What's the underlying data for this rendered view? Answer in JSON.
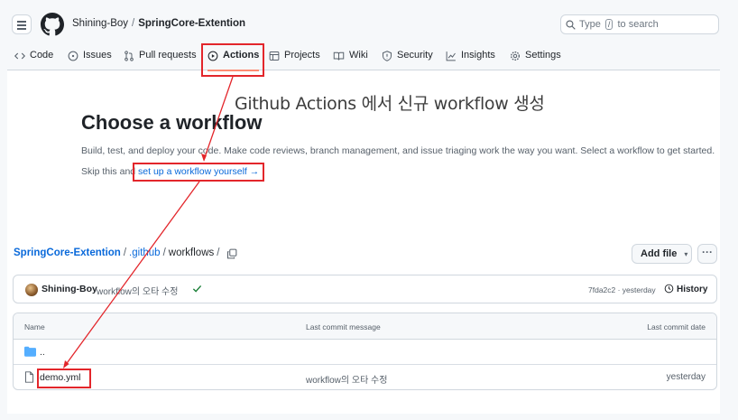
{
  "header": {
    "owner": "Shining-Boy",
    "separator": "/",
    "repo": "SpringCore-Extention",
    "search_prefix": "Type",
    "search_key": "/",
    "search_suffix": "to search"
  },
  "tabs": [
    {
      "label": "Code",
      "icon": "code-icon"
    },
    {
      "label": "Issues",
      "icon": "issue-icon"
    },
    {
      "label": "Pull requests",
      "icon": "pull-request-icon"
    },
    {
      "label": "Actions",
      "icon": "play-icon",
      "selected": true
    },
    {
      "label": "Projects",
      "icon": "table-icon"
    },
    {
      "label": "Wiki",
      "icon": "book-icon"
    },
    {
      "label": "Security",
      "icon": "shield-icon"
    },
    {
      "label": "Insights",
      "icon": "graph-icon"
    },
    {
      "label": "Settings",
      "icon": "gear-icon"
    }
  ],
  "annotation": "Github Actions 에서 신규 workflow 생성",
  "main": {
    "title": "Choose a workflow",
    "description": "Build, test, and deploy your code. Make code reviews, branch management, and issue triaging work the way you want. Select a workflow to get started.",
    "skip_prefix": "Skip this and",
    "skip_link": "set up a workflow yourself",
    "skip_arrow": "→"
  },
  "path": {
    "repo": "SpringCore-Extention",
    "dir1": ".github",
    "dir2": "workflows",
    "sep": "/"
  },
  "buttons": {
    "add_file": "Add file",
    "add_file_caret": "▾",
    "more": "···"
  },
  "commit": {
    "author": "Shining-Boy",
    "message": "workflow의 오타 수정",
    "hash_time": "7fda2c2 · yesterday",
    "history": "History"
  },
  "table": {
    "headers": {
      "name": "Name",
      "message": "Last commit message",
      "date": "Last commit date"
    },
    "rows": [
      {
        "name": "..",
        "type": "folder",
        "message": "",
        "date": ""
      },
      {
        "name": "demo.yml",
        "type": "file",
        "message": "workflow의 오타 수정",
        "date": "yesterday"
      }
    ]
  },
  "colors": {
    "accent": "#0969da",
    "annotation_red": "#e3262b",
    "tab_underline": "#fd8c73",
    "success": "#1a7f37"
  }
}
